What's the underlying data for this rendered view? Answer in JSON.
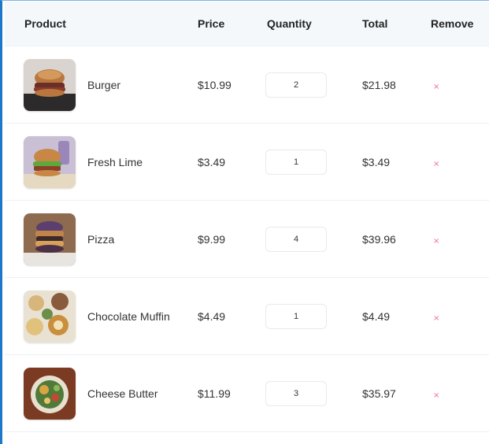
{
  "table": {
    "headers": {
      "product": "Product",
      "price": "Price",
      "quantity": "Quantity",
      "total": "Total",
      "remove": "Remove"
    },
    "rows": [
      {
        "name": "Burger",
        "price": "$10.99",
        "quantity": "2",
        "total": "$21.98",
        "remove_icon": "close-icon",
        "remove_symbol": "×"
      },
      {
        "name": "Fresh Lime",
        "price": "$3.49",
        "quantity": "1",
        "total": "$3.49",
        "remove_icon": "close-icon",
        "remove_symbol": "×"
      },
      {
        "name": "Pizza",
        "price": "$9.99",
        "quantity": "4",
        "total": "$39.96",
        "remove_icon": "close-icon",
        "remove_symbol": "×"
      },
      {
        "name": "Chocolate Muffin",
        "price": "$4.49",
        "quantity": "1",
        "total": "$4.49",
        "remove_icon": "close-icon",
        "remove_symbol": "×"
      },
      {
        "name": "Cheese Butter",
        "price": "$11.99",
        "quantity": "3",
        "total": "$35.97",
        "remove_icon": "close-icon",
        "remove_symbol": "×"
      }
    ]
  },
  "colors": {
    "header_bg": "#f5f8fb",
    "remove_accent": "#f06b8a",
    "frame_accent": "#1e78c8"
  }
}
